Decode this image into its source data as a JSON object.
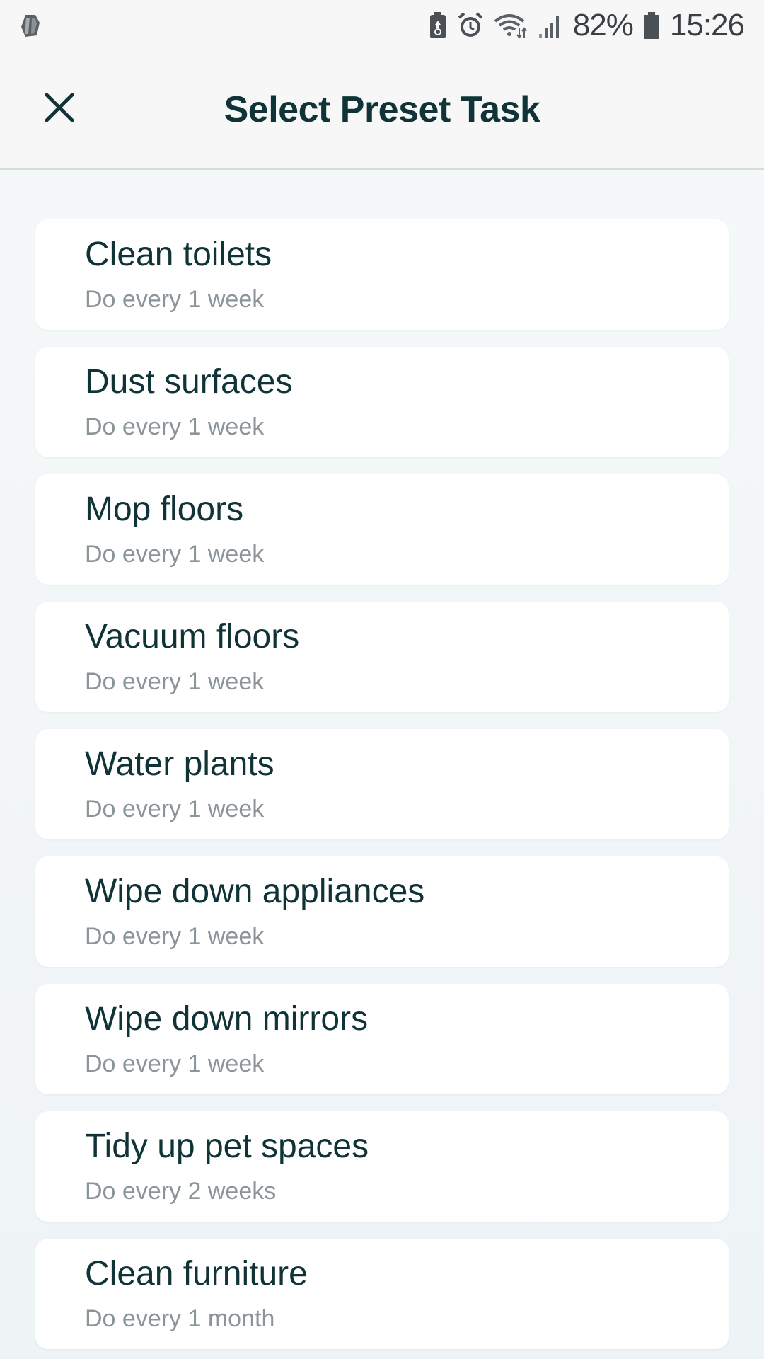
{
  "status_bar": {
    "battery_percent": "82%",
    "time": "15:26",
    "icons": [
      "app-notification-icon",
      "battery-saver-icon",
      "alarm-icon",
      "wifi-icon",
      "signal-icon",
      "battery-icon"
    ]
  },
  "header": {
    "title": "Select Preset Task",
    "close_icon": "close-icon"
  },
  "tasks": [
    {
      "title": "Clean toilets",
      "subtitle": "Do every 1 week"
    },
    {
      "title": "Dust surfaces",
      "subtitle": "Do every 1 week"
    },
    {
      "title": "Mop floors",
      "subtitle": "Do every 1 week"
    },
    {
      "title": "Vacuum floors",
      "subtitle": "Do every 1 week"
    },
    {
      "title": "Water plants",
      "subtitle": "Do every 1 week"
    },
    {
      "title": "Wipe down appliances",
      "subtitle": "Do every 1 week"
    },
    {
      "title": "Wipe down mirrors",
      "subtitle": "Do every 1 week"
    },
    {
      "title": "Tidy up pet spaces",
      "subtitle": "Do every 2 weeks"
    },
    {
      "title": "Clean furniture",
      "subtitle": "Do every 1 month"
    }
  ],
  "colors": {
    "title_text": "#0f3336",
    "subtitle_text": "#8a9499",
    "card_background": "#ffffff",
    "page_background": "#f5f8f9"
  }
}
